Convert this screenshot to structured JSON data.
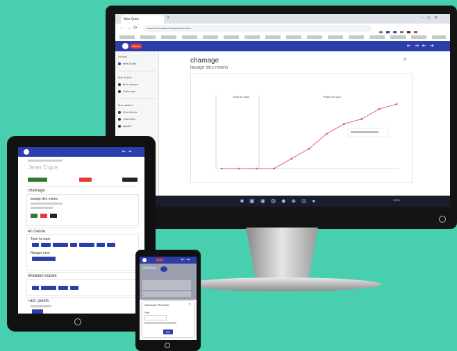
{
  "colors": {
    "background": "#47cfb0",
    "app_primary": "#2c3eaa",
    "accent_red": "#e53935",
    "chart_line": "#e0567a",
    "device_frame": "#141414"
  },
  "monitor": {
    "browser": {
      "tab_title": "Mes Suivi",
      "url": "www.suivi.pasteur.fr/app/index.html"
    },
    "app_bar": {
      "badge": "Admin"
    },
    "sidebar": {
      "items": [
        "Accueil",
        "Mes Suivis",
        "Mes Suivis",
        "Mes classes",
        "Historique",
        "Mes ateliers",
        "Mes élèves",
        "Calendrier",
        "Ajouter"
      ]
    },
    "content": {
      "title": "chamage",
      "subtitle": "lavage des mains",
      "chart_panel_label_left": "Seuil de base",
      "chart_panel_label_right": "Phase de suivi"
    },
    "taskbar_time": "10:31"
  },
  "chart_data": {
    "type": "line",
    "title": "",
    "xlabel": "",
    "ylabel": "",
    "series": [
      {
        "name": "",
        "x": [
          1,
          2,
          3,
          4,
          5,
          6,
          7,
          8,
          9,
          10,
          11
        ],
        "values": [
          0,
          0,
          0,
          0,
          1,
          2,
          3.5,
          4.5,
          5,
          6,
          6.5
        ]
      }
    ],
    "ylim": [
      0,
      7
    ],
    "grid": false
  },
  "tablet": {
    "title": "Jean Dupe",
    "section_1": "chamage",
    "section_1_sub": "lavage des mains",
    "section_2": "en classe",
    "section_2_sub_1": "Tenir la main",
    "section_2_sub_2": "Ranger mon",
    "section_3": "Imitation vocale",
    "section_4": "Tact. jouets"
  },
  "phone": {
    "title": "Séance",
    "dialog_title": "Nouveau / Résumer",
    "dialog_label": "Hier",
    "ok_label": "OK"
  }
}
